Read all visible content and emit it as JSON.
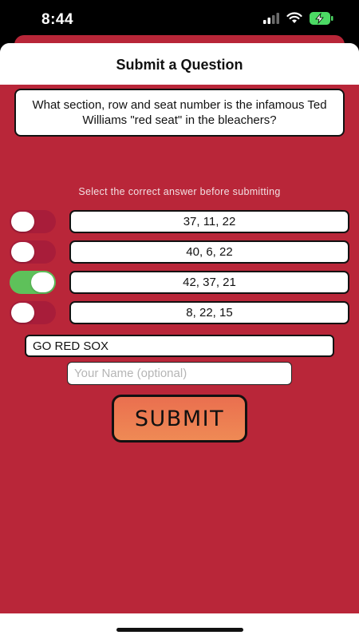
{
  "status_bar": {
    "time": "8:44"
  },
  "sheet": {
    "title": "Submit a Question"
  },
  "question": {
    "text": "What section, row and seat number is the infamous Ted Williams \"red seat\" in the bleachers?"
  },
  "instruction": "Select the correct answer before submitting",
  "answers": [
    {
      "text": "37, 11, 22",
      "selected": false
    },
    {
      "text": "40, 6, 22",
      "selected": false
    },
    {
      "text": "42, 37, 21",
      "selected": true
    },
    {
      "text": "8, 22, 15",
      "selected": false
    }
  ],
  "message_field": {
    "value": "GO RED SOX"
  },
  "name_field": {
    "placeholder": "Your Name (optional)"
  },
  "submit": {
    "label": "SUBMIT"
  },
  "colors": {
    "background": "#b92639",
    "toggle_on": "#5ec15a",
    "submit_button": "#ec7b52"
  },
  "icons": [
    "signal-icon",
    "wifi-icon",
    "battery-charging-icon"
  ]
}
